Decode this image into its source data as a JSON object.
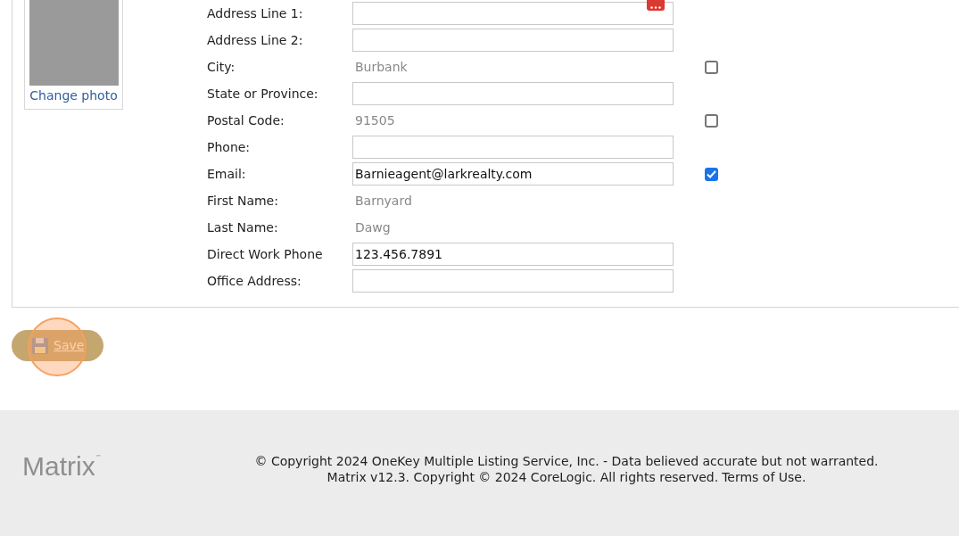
{
  "profile": {
    "change_photo": "Change photo"
  },
  "fields": [
    {
      "label": "Address Line 1:",
      "kind": "input",
      "picker": true
    },
    {
      "label": "Address Line 2:",
      "kind": "input"
    },
    {
      "label": "City:",
      "kind": "text",
      "value": "Burbank",
      "checked": false
    },
    {
      "label": "State or Province:",
      "kind": "input"
    },
    {
      "label": "Postal Code:",
      "kind": "text",
      "value": "91505",
      "checked": false
    },
    {
      "label": "Phone:",
      "kind": "input"
    },
    {
      "label": "Email:",
      "kind": "input",
      "value": "Barnieagent@larkrealty.com",
      "checked": true
    },
    {
      "label": "First Name:",
      "kind": "text",
      "value": "Barnyard"
    },
    {
      "label": "Last Name:",
      "kind": "text",
      "value": "Dawg"
    },
    {
      "label": "Direct Work Phone",
      "kind": "input",
      "value": "123.456.7891"
    },
    {
      "label": "Office Address:",
      "kind": "input"
    }
  ],
  "save_button": "Save",
  "footer": {
    "logo": "Matrix",
    "trademark": "™",
    "line_1": "© Copyright 2024 OneKey Multiple Listing Service, Inc. - Data believed accurate but not warranted.",
    "line_2_text": "Matrix v12.3. Copyright © 2024 CoreLogic. All rights reserved.",
    "terms_link": "Terms of Use."
  }
}
